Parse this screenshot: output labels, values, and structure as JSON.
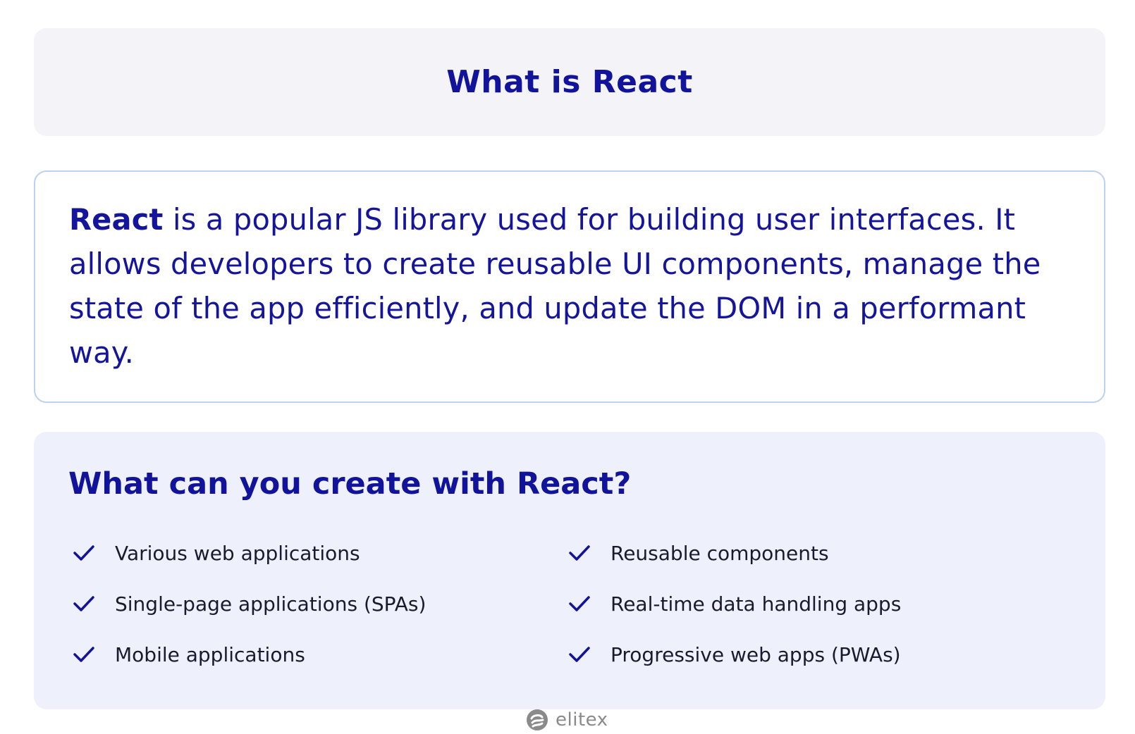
{
  "header": {
    "title": "What is React"
  },
  "description": {
    "highlight": "React",
    "text": " is a popular JS library used for building user interfaces. It allows developers to create reusable UI components, manage the state of the app efficiently, and update the DOM in a performant way."
  },
  "uses": {
    "heading": "What can you create with React?",
    "left_items": [
      "Various web applications",
      "Single-page applications (SPAs)",
      "Mobile applications"
    ],
    "right_items": [
      "Reusable components",
      "Real-time data handling apps",
      "Progressive web apps (PWAs)"
    ],
    "icon": "check-icon"
  },
  "brand": {
    "name": "elitex",
    "icon": "elitex-logo-icon"
  },
  "colors": {
    "primary_text": "#11139a",
    "title_background": "#f3f3f8",
    "list_background": "#eef1fc",
    "card_border": "#bcd0f5",
    "item_text": "#1a1a2e",
    "logo_gray": "#8a8a8a"
  }
}
